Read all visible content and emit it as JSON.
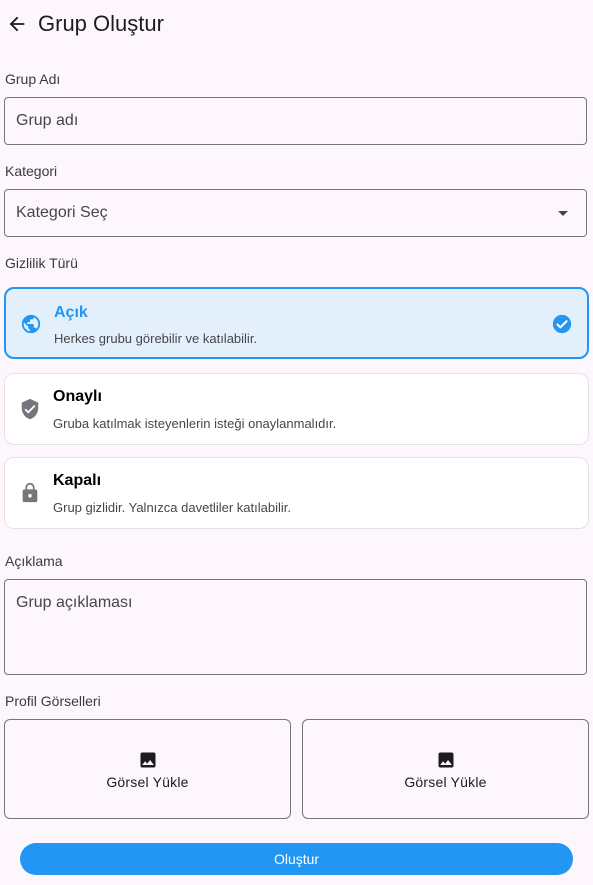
{
  "app_bar": {
    "title": "Grup Oluştur",
    "back_icon": "arrow-left-icon"
  },
  "group_name": {
    "label": "Grup Adı",
    "placeholder": "Grup adı",
    "value": ""
  },
  "category": {
    "label": "Kategori",
    "selected": "Kategori Seç",
    "icon": "dropdown-arrow-icon"
  },
  "privacy": {
    "label": "Gizlilik Türü",
    "selected_index": 0,
    "options": [
      {
        "title": "Açık",
        "description": "Herkes grubu görebilir ve katılabilir.",
        "icon": "globe-icon"
      },
      {
        "title": "Onaylı",
        "description": "Gruba katılmak isteyenlerin isteği onaylanmalıdır.",
        "icon": "verified-shield-icon"
      },
      {
        "title": "Kapalı",
        "description": "Grup gizlidir. Yalnızca davetliler katılabilir.",
        "icon": "lock-icon"
      }
    ]
  },
  "description": {
    "label": "Açıklama",
    "placeholder": "Grup açıklaması",
    "value": ""
  },
  "images": {
    "label": "Profil Görselleri",
    "uploads": [
      {
        "label": "Görsel Yükle",
        "icon": "image-icon"
      },
      {
        "label": "Görsel Yükle",
        "icon": "image-icon"
      }
    ]
  },
  "submit": {
    "label": "Oluştur"
  },
  "colors": {
    "accent": "#2196f3",
    "background": "#fdf7fd",
    "selected_card_bg": "#e3f0fb",
    "icon_gray": "#77757c"
  }
}
